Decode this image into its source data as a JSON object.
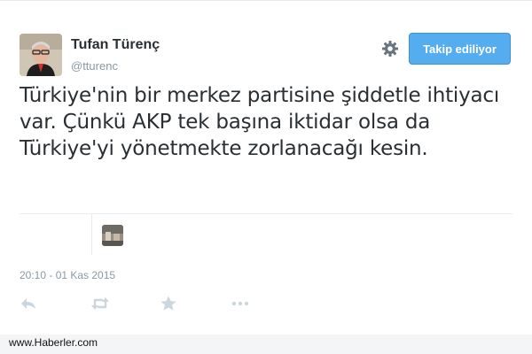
{
  "user": {
    "name": "Tufan Türenç",
    "handle": "@tturenc"
  },
  "follow_button": {
    "label": "Takip ediliyor"
  },
  "tweet": {
    "text": "Türkiye'nin bir merkez partisine şiddetle ihtiyacı var. Çünkü AKP tek başına iktidar olsa da Türkiye'yi yönetmekte zorlanacağı kesin.",
    "timestamp": "20:10 - 01 Kas 2015"
  },
  "icons": {
    "settings": "gear-icon",
    "reply": "reply-icon",
    "retweet": "retweet-icon",
    "favorite": "star-icon",
    "more": "more-icon"
  },
  "colors": {
    "accent": "#55acee",
    "text": "#292f33",
    "muted": "#8899a6",
    "icon": "#ccd6dd"
  },
  "footer": {
    "watermark": "www.Haberler.com"
  }
}
